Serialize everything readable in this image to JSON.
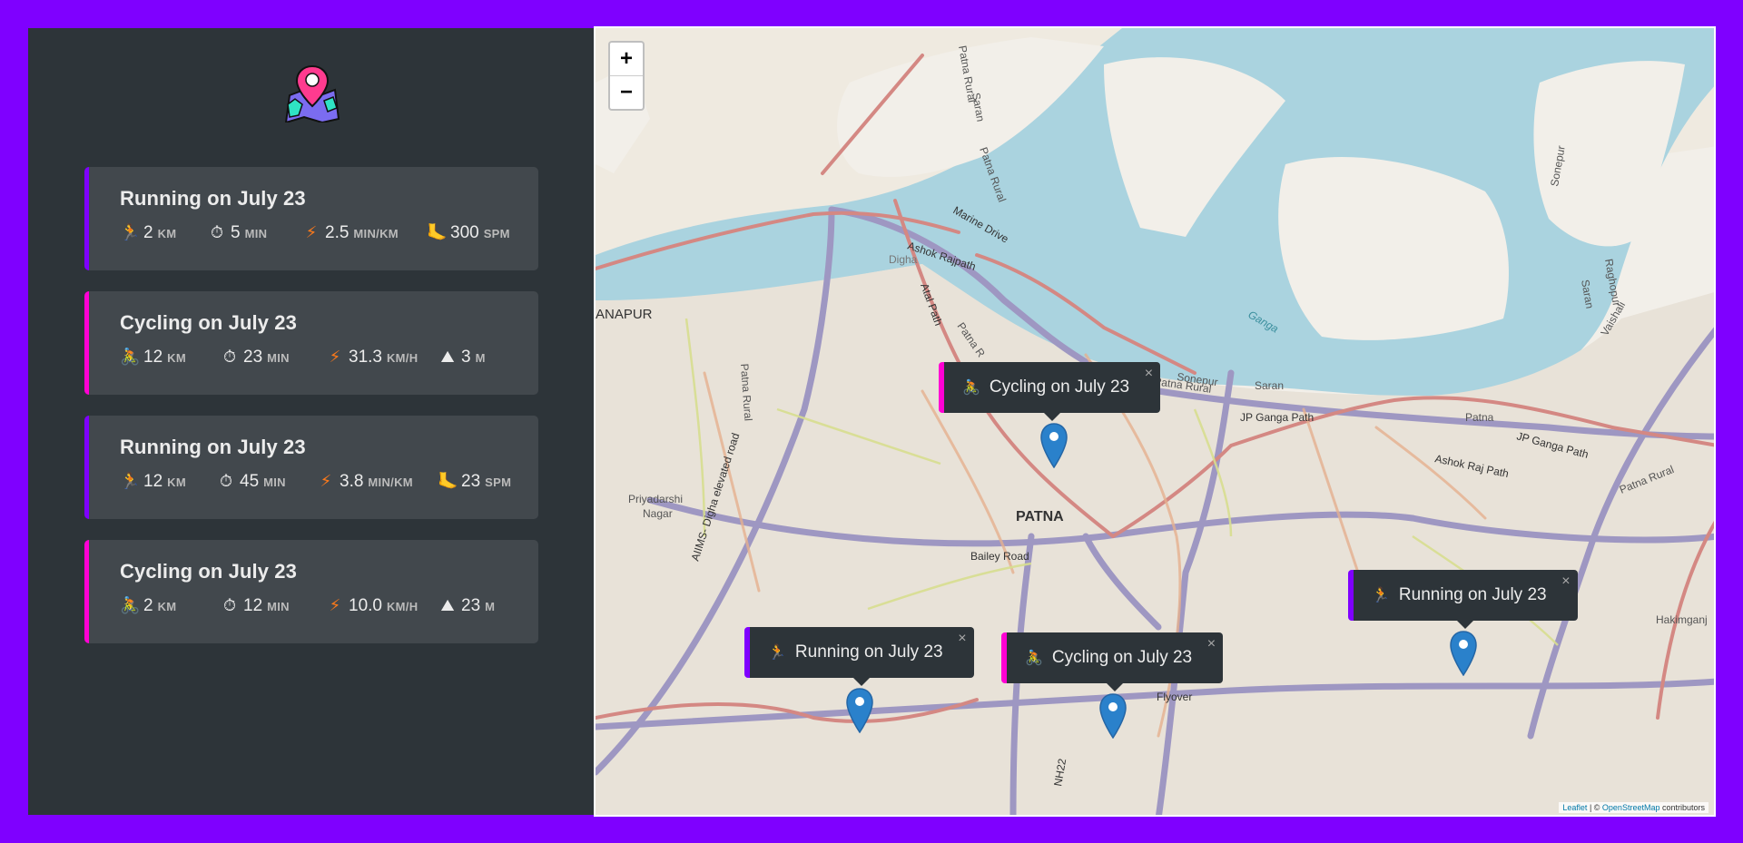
{
  "brand": {
    "logo_icon": "map-pin-logo"
  },
  "colors": {
    "background": "#7f00ff",
    "sidebar": "#2d3439",
    "card": "#42484d",
    "running_accent": "#7f00ff",
    "cycling_accent": "#ff00d4"
  },
  "workouts": [
    {
      "type": "running",
      "title": "Running on July 23",
      "distance": "2",
      "distance_unit": "km",
      "duration": "5",
      "duration_unit": "min",
      "pace_label": "2.5",
      "pace_unit": "min/km",
      "extra": "300",
      "extra_unit": "spm"
    },
    {
      "type": "cycling",
      "title": "Cycling on July 23",
      "distance": "12",
      "distance_unit": "km",
      "duration": "23",
      "duration_unit": "min",
      "pace_label": "31.3",
      "pace_unit": "km/h",
      "extra": "3",
      "extra_unit": "m"
    },
    {
      "type": "running",
      "title": "Running on July 23",
      "distance": "12",
      "distance_unit": "km",
      "duration": "45",
      "duration_unit": "min",
      "pace_label": "3.8",
      "pace_unit": "min/km",
      "extra": "23",
      "extra_unit": "spm"
    },
    {
      "type": "cycling",
      "title": "Cycling on July 23",
      "distance": "2",
      "distance_unit": "km",
      "duration": "12",
      "duration_unit": "min",
      "pace_label": "10.0",
      "pace_unit": "km/h",
      "extra": "23",
      "extra_unit": "m"
    }
  ],
  "map": {
    "zoom_in": "+",
    "zoom_out": "−",
    "attribution_leaflet": "Leaflet",
    "attribution_sep": " | © ",
    "attribution_osm": "OpenStreetMap",
    "attribution_tail": " contributors",
    "labels": {
      "patna": "PATNA",
      "bailey_road": "Bailey Road",
      "marine_drive": "Marine Drive",
      "ashok_rajpath": "Ashok Rajpath",
      "atal_path": "Atal Path",
      "jp_ganga_path": "JP Ganga Path",
      "jp_ganga_path_2": "JP Ganga Path",
      "ashok_raj_path": "Ashok Raj Path",
      "patna_rural": "Patna Rural",
      "patna_rural_2": "Patna Rural",
      "sonepur": "Sonepur",
      "saran": "Saran",
      "ganga": "Ganga",
      "danapur": "ANAPUR",
      "priyadarshi": "Priyadarshi",
      "nagar": "Nagar",
      "digha": "Digha",
      "aiims": "AIIMS- Digha elevated road",
      "flyover": "Flyover",
      "nh22": "NH22",
      "patna_rural_3": "Patna Rural",
      "patna_rural_4": "Patna Rural",
      "patna_label": "Patna",
      "hakimganj": "Hakimganj",
      "patna_r": "Patna R",
      "sonepur_2": "Sonepur",
      "saran_2": "Saran",
      "raghopur": "Raghopur",
      "vaishali": "Vaishali",
      "saran_3": "Saran",
      "patna_rural_5": "Patna Rural"
    },
    "popups": [
      {
        "type": "cycling",
        "icon": "🚴",
        "text": "Cycling on July 23",
        "close": "×"
      },
      {
        "type": "running",
        "icon": "🏃",
        "text": "Running on July 23",
        "close": "×"
      },
      {
        "type": "cycling",
        "icon": "🚴",
        "text": "Cycling on July 23",
        "close": "×"
      },
      {
        "type": "running",
        "icon": "🏃",
        "text": "Running on July 23",
        "close": "×"
      }
    ]
  }
}
